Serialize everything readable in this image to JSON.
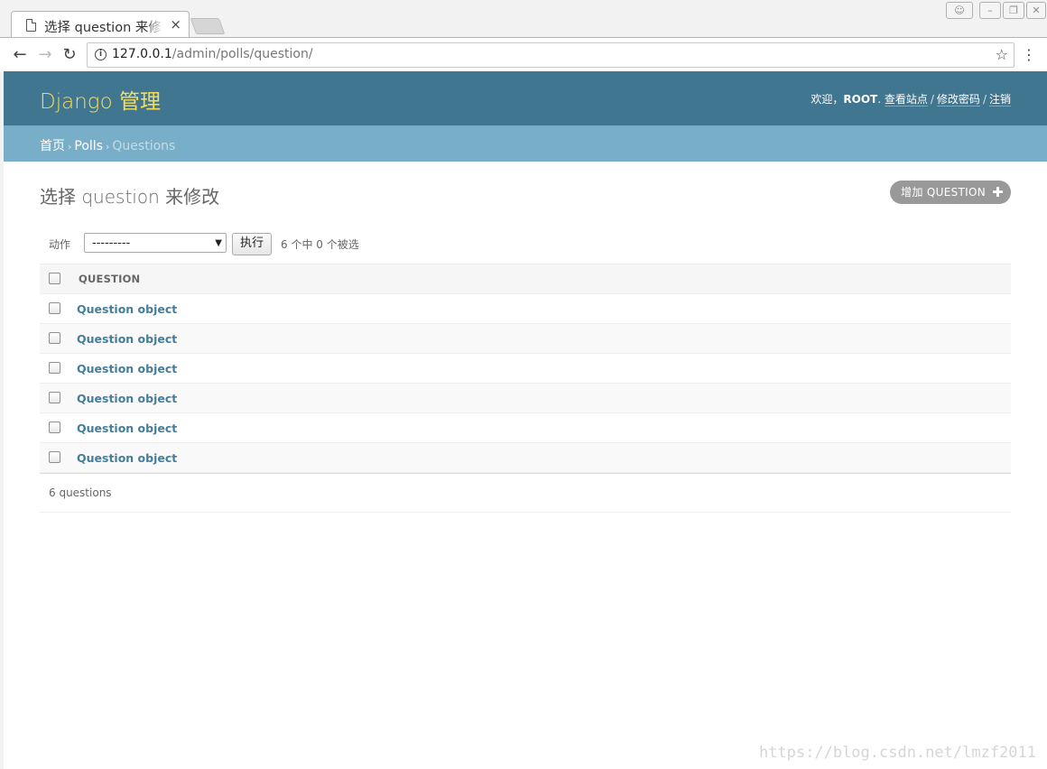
{
  "browser": {
    "tab_title": "选择 question 来修改",
    "tab_close": "×",
    "url_host": "127.0.0.1",
    "url_path": "/admin/polls/question/",
    "icons": [
      "page-icon",
      "back-icon",
      "forward-icon",
      "reload-icon",
      "info-icon",
      "star-icon",
      "menu-icon",
      "profile-icon",
      "minimize-icon",
      "restore-icon",
      "close-icon"
    ]
  },
  "header": {
    "brand": "Django 管理",
    "welcome": "欢迎，",
    "username": "ROOT",
    "view_site": "查看站点",
    "change_password": "修改密码",
    "logout": "注销",
    "separator": "/"
  },
  "breadcrumbs": {
    "home": "首页",
    "app": "Polls",
    "current": "Questions",
    "separator": "›"
  },
  "content": {
    "title": "选择 question 来修改",
    "add_button": "增加 QUESTION"
  },
  "actions": {
    "label": "动作",
    "selected_option": "---------",
    "go_button": "执行",
    "counter": "6 个中 0 个被选"
  },
  "table": {
    "column": "QUESTION",
    "rows": [
      "Question object",
      "Question object",
      "Question object",
      "Question object",
      "Question object",
      "Question object"
    ]
  },
  "paginator": {
    "text": "6 questions"
  },
  "watermark": "https://blog.csdn.net/lmzf2011",
  "colors": {
    "header": "#417690",
    "breadcrumbs": "#79aec8",
    "brand": "#f5dd5d",
    "link": "#447e9b"
  }
}
